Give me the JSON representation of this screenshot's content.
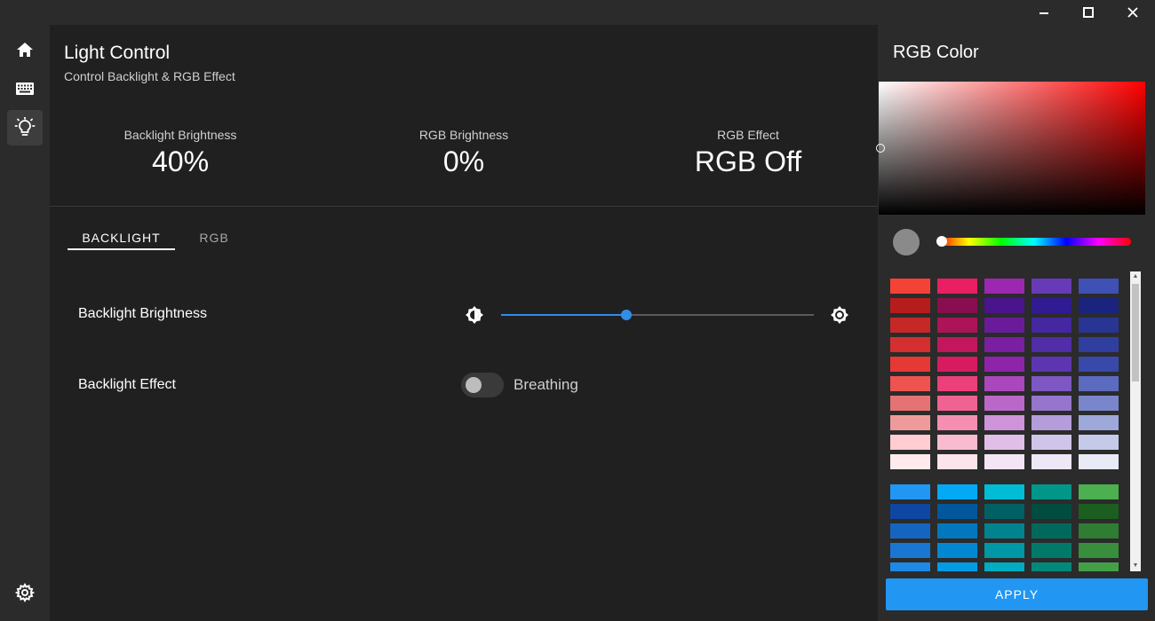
{
  "page": {
    "title": "Light Control",
    "subtitle": "Control Backlight & RGB Effect"
  },
  "stats": {
    "backlight_brightness_label": "Backlight Brightness",
    "backlight_brightness_value": "40%",
    "rgb_brightness_label": "RGB Brightness",
    "rgb_brightness_value": "0%",
    "rgb_effect_label": "RGB Effect",
    "rgb_effect_value": "RGB Off"
  },
  "tabs": [
    {
      "label": "BACKLIGHT",
      "active": true
    },
    {
      "label": "RGB",
      "active": false
    }
  ],
  "backlight": {
    "brightness_label": "Backlight Brightness",
    "brightness_fraction": 0.4,
    "effect_label": "Backlight Effect",
    "effect_toggle_label": "Breathing",
    "effect_on": false
  },
  "sidebar": {
    "items": [
      {
        "icon": "home-icon"
      },
      {
        "icon": "keyboard-icon"
      },
      {
        "icon": "lightbulb-icon",
        "active": true
      },
      {
        "icon": "gear-icon"
      }
    ]
  },
  "rgb_panel": {
    "title": "RGB Color",
    "hue_color": "#ff0000",
    "selected_color": "#8a8a8a",
    "hue_fraction": 0.0,
    "apply_label": "APPLY",
    "swatch_groups": [
      [
        [
          "#f44336",
          "#e91e63",
          "#9c27b0",
          "#673ab7",
          "#3f51b5"
        ],
        [
          "#b71c1c",
          "#880e4f",
          "#4a148c",
          "#311b92",
          "#1a237e"
        ],
        [
          "#c62828",
          "#ad1457",
          "#6a1b9a",
          "#4527a0",
          "#283593"
        ],
        [
          "#d32f2f",
          "#c2185b",
          "#7b1fa2",
          "#512da8",
          "#303f9f"
        ],
        [
          "#e53935",
          "#d81b60",
          "#8e24aa",
          "#5e35b1",
          "#3949ab"
        ],
        [
          "#ef5350",
          "#ec407a",
          "#ab47bc",
          "#7e57c2",
          "#5c6bc0"
        ],
        [
          "#e57373",
          "#f06292",
          "#ba68c8",
          "#9575cd",
          "#7986cb"
        ],
        [
          "#ef9a9a",
          "#f48fb1",
          "#ce93d8",
          "#b39ddb",
          "#9fa8da"
        ],
        [
          "#ffcdd2",
          "#f8bbd0",
          "#e1bee7",
          "#d1c4e9",
          "#c5cae9"
        ],
        [
          "#ffebee",
          "#fce4ec",
          "#f3e5f5",
          "#ede7f6",
          "#e8eaf6"
        ]
      ],
      [
        [
          "#2196f3",
          "#03a9f4",
          "#00bcd4",
          "#009688",
          "#4caf50"
        ],
        [
          "#0d47a1",
          "#01579b",
          "#006064",
          "#004d40",
          "#1b5e20"
        ],
        [
          "#1565c0",
          "#0277bd",
          "#00838f",
          "#00695c",
          "#2e7d32"
        ],
        [
          "#1976d2",
          "#0288d1",
          "#0097a7",
          "#00796b",
          "#388e3c"
        ],
        [
          "#1e88e5",
          "#039be5",
          "#00acc1",
          "#00897b",
          "#43a047"
        ]
      ]
    ]
  }
}
